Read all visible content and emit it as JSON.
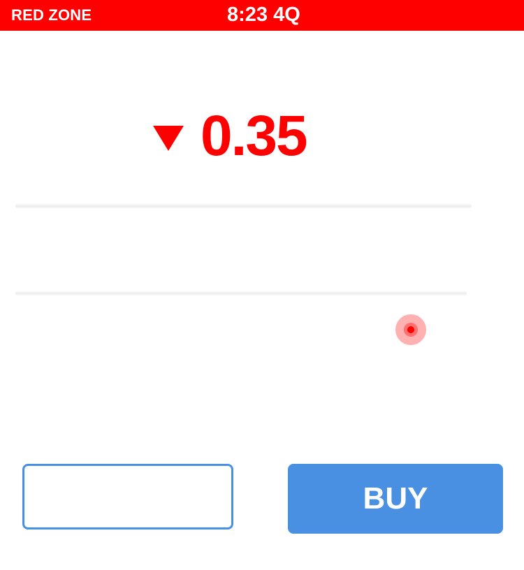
{
  "status_bar": {
    "left_label": "RED ZONE",
    "center_label": "8:23 4Q",
    "background_color": "#ff0000"
  },
  "price": {
    "direction_icon": "triangle-down-icon",
    "value": "0.35",
    "color": "#ff0000"
  },
  "actions": {
    "left_button_label": "",
    "buy_label": "BUY",
    "accent_color": "#4a90e2"
  },
  "touch_indicator": {
    "icon": "touch-point-icon"
  }
}
